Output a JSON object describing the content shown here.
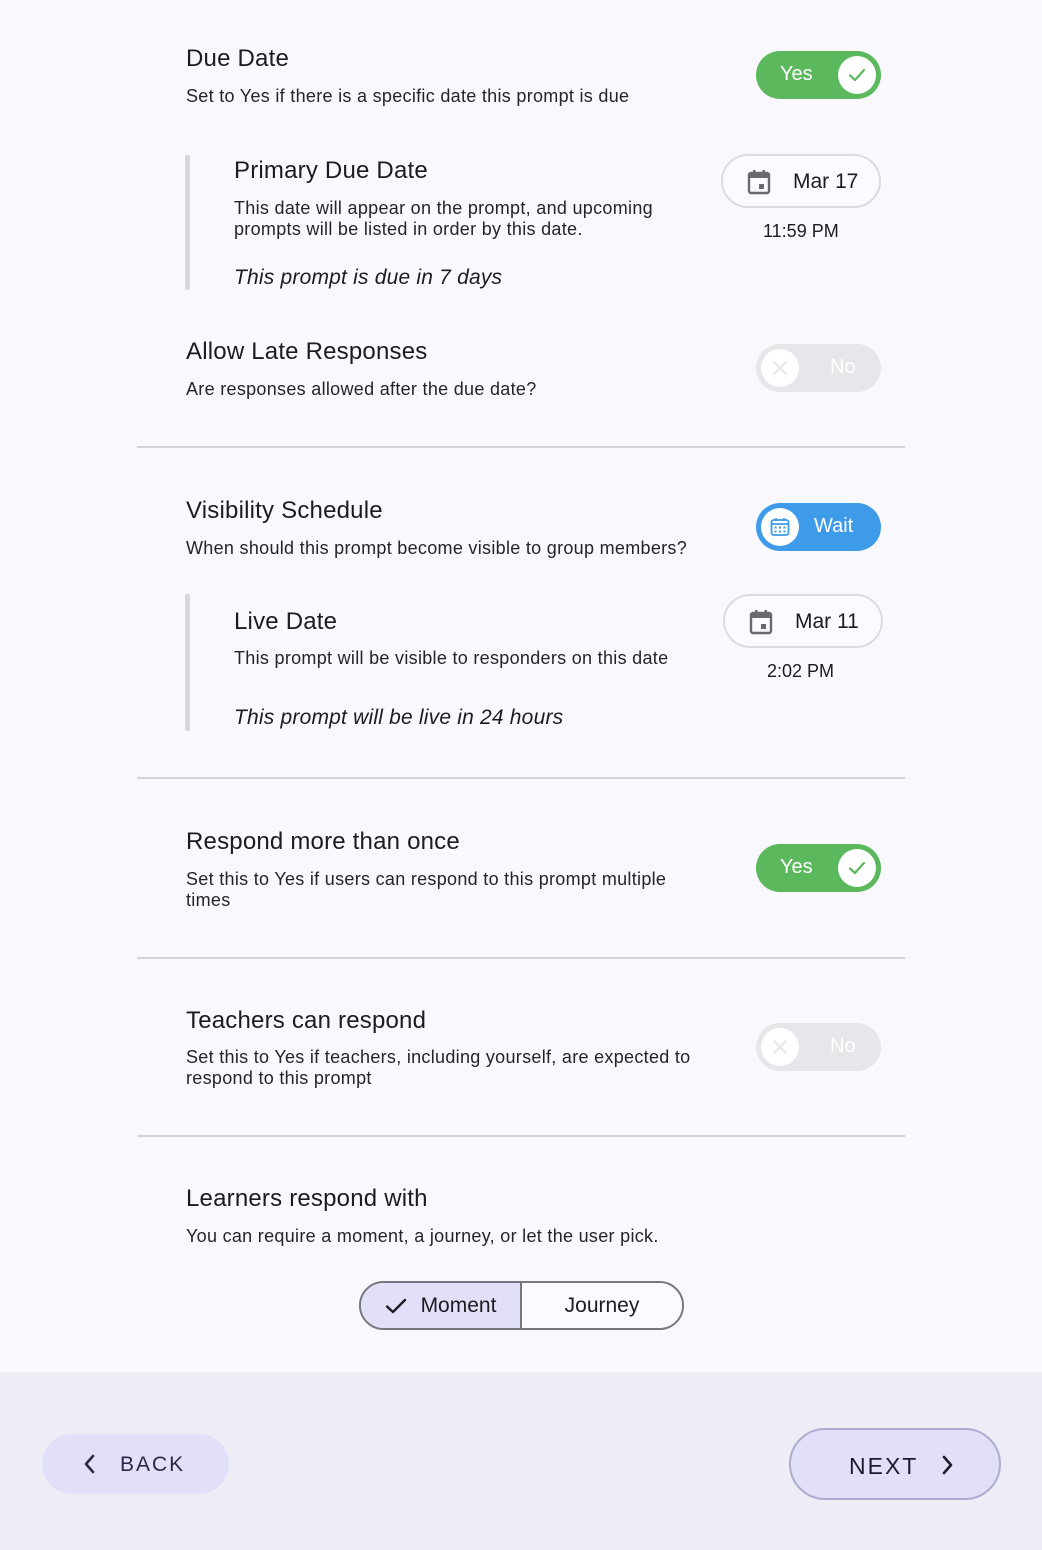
{
  "due_date": {
    "title": "Due Date",
    "description": "Set to Yes if there is a specific date this prompt is due",
    "toggle": "Yes",
    "primary": {
      "title": "Primary Due Date",
      "description_line1": "This date will appear on the prompt, and upcoming",
      "description_line2": "prompts will be listed in order by this date.",
      "note": "This prompt is due in 7 days",
      "date": "Mar 17",
      "time": "11:59 PM"
    }
  },
  "late_responses": {
    "title": "Allow Late Responses",
    "description": "Are responses allowed after the due date?",
    "toggle": "No"
  },
  "visibility": {
    "title": "Visibility Schedule",
    "description": "When should this prompt become visible to group members?",
    "toggle": "Wait",
    "live": {
      "title": "Live Date",
      "description": "This prompt will be visible to responders on this date",
      "note": "This prompt will be live in 24 hours",
      "date": "Mar 11",
      "time": "2:02 PM"
    }
  },
  "respond_more": {
    "title": "Respond more than once",
    "description_line1": "Set this to Yes if users can respond to this prompt multiple",
    "description_line2": "times",
    "toggle": "Yes"
  },
  "teachers": {
    "title": "Teachers can respond",
    "description_line1": "Set this to Yes if teachers, including yourself, are expected to",
    "description_line2": "respond to this prompt",
    "toggle": "No"
  },
  "learners": {
    "title": "Learners respond with",
    "description": "You can require a moment, a journey, or let the user pick.",
    "options": [
      "Moment",
      "Journey"
    ],
    "selected": "Moment"
  },
  "footer": {
    "back": "BACK",
    "next": "NEXT"
  },
  "colors": {
    "yes_green": "#5cb85c",
    "wait_blue": "#3d9be9",
    "no_gray": "#e7e6eb",
    "accent_lavender": "#e1e0f8"
  }
}
